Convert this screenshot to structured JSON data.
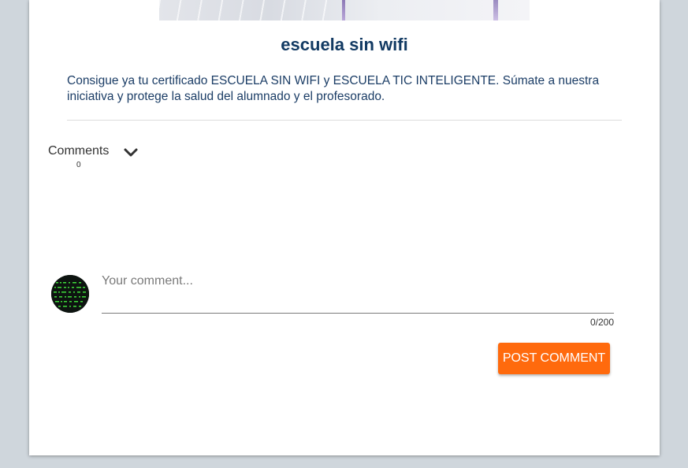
{
  "post": {
    "title": "escuela sin wifi",
    "description": "Consigue ya tu certificado ESCUELA SIN WIFI y ESCUELA TIC INTELIGENTE. Súmate a nuestra iniciativa y protege la salud del alumnado y el profesorado."
  },
  "comments": {
    "label": "Comments",
    "count": "0",
    "toggle_icon": "chevron-down-icon",
    "input_placeholder": "Your comment...",
    "input_value": "",
    "char_counter": "0/200",
    "post_button_label": "POST COMMENT"
  },
  "colors": {
    "title": "#123a63",
    "accent_button": "#ff6a0d",
    "page_background": "#cfd6dc"
  }
}
